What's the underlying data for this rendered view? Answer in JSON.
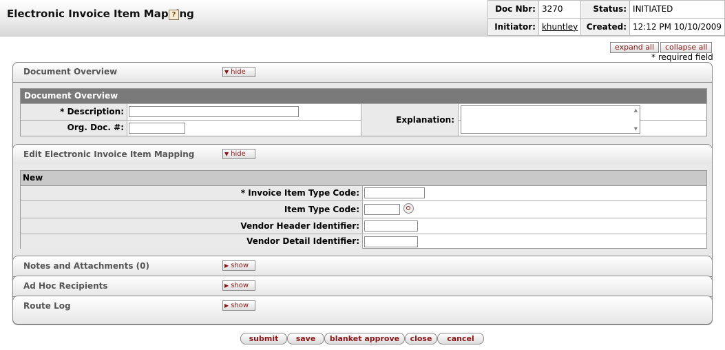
{
  "header": {
    "title": "Electronic Invoice Item Mapping",
    "help_icon": "?",
    "doc_nbr_label": "Doc Nbr:",
    "doc_nbr": "3270",
    "status_label": "Status:",
    "status": "INITIATED",
    "initiator_label": "Initiator:",
    "initiator": "khuntley",
    "created_label": "Created:",
    "created": "12:12 PM 10/10/2009"
  },
  "toolbar": {
    "expand_all": "expand all",
    "collapse_all": "collapse all",
    "required_note": "* required field"
  },
  "tabs": {
    "document_overview": {
      "title": "Document Overview",
      "toggle": "hide"
    },
    "edit_mapping": {
      "title": "Edit Electronic Invoice Item Mapping",
      "toggle": "hide"
    },
    "notes": {
      "title": "Notes and Attachments (0)",
      "toggle": "show"
    },
    "adhoc": {
      "title": "Ad Hoc Recipients",
      "toggle": "show"
    },
    "route_log": {
      "title": "Route Log",
      "toggle": "show"
    }
  },
  "document_overview": {
    "heading": "Document Overview",
    "description_label": "* Description:",
    "description_value": "",
    "org_doc_label": "Org. Doc. #:",
    "org_doc_value": "",
    "explanation_label": "Explanation:",
    "explanation_value": ""
  },
  "mapping": {
    "heading": "New",
    "fields": [
      {
        "label": "*  Invoice Item Type Code:",
        "value": ""
      },
      {
        "label": "Item Type Code:",
        "value": ""
      },
      {
        "label": "Vendor Header Identifier:",
        "value": ""
      },
      {
        "label": "Vendor Detail Identifier:",
        "value": ""
      }
    ]
  },
  "actions": {
    "submit": "submit",
    "save": "save",
    "blanket_approve": "blanket approve",
    "close": "close",
    "cancel": "cancel"
  },
  "colors": {
    "button_text": "#8b1414",
    "section_header_dark": "#7a7a7a",
    "section_header_light": "#c9c9c9"
  }
}
